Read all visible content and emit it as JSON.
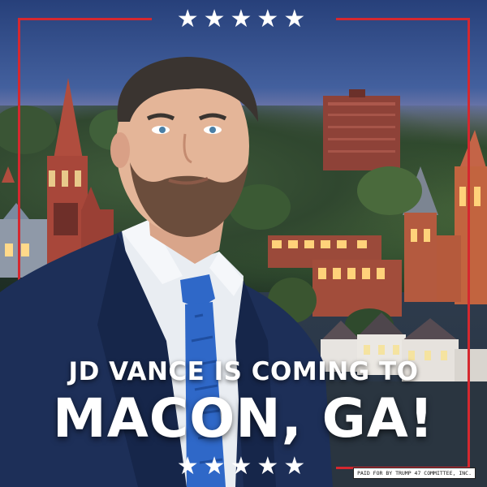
{
  "top_stars": "★★★★★",
  "bottom_stars": "★★★★★",
  "headline": {
    "line1": "JD VANCE IS COMING TO",
    "line2": "MACON, GA!"
  },
  "disclaimer": "PAID FOR BY TRUMP 47 COMMITTEE, INC.",
  "colors": {
    "frame_red": "#d5282f",
    "suit_navy": "#1d2f58",
    "tie_blue": "#2f68c8",
    "sky_blue": "#43609e",
    "brick": "#a8473a"
  }
}
